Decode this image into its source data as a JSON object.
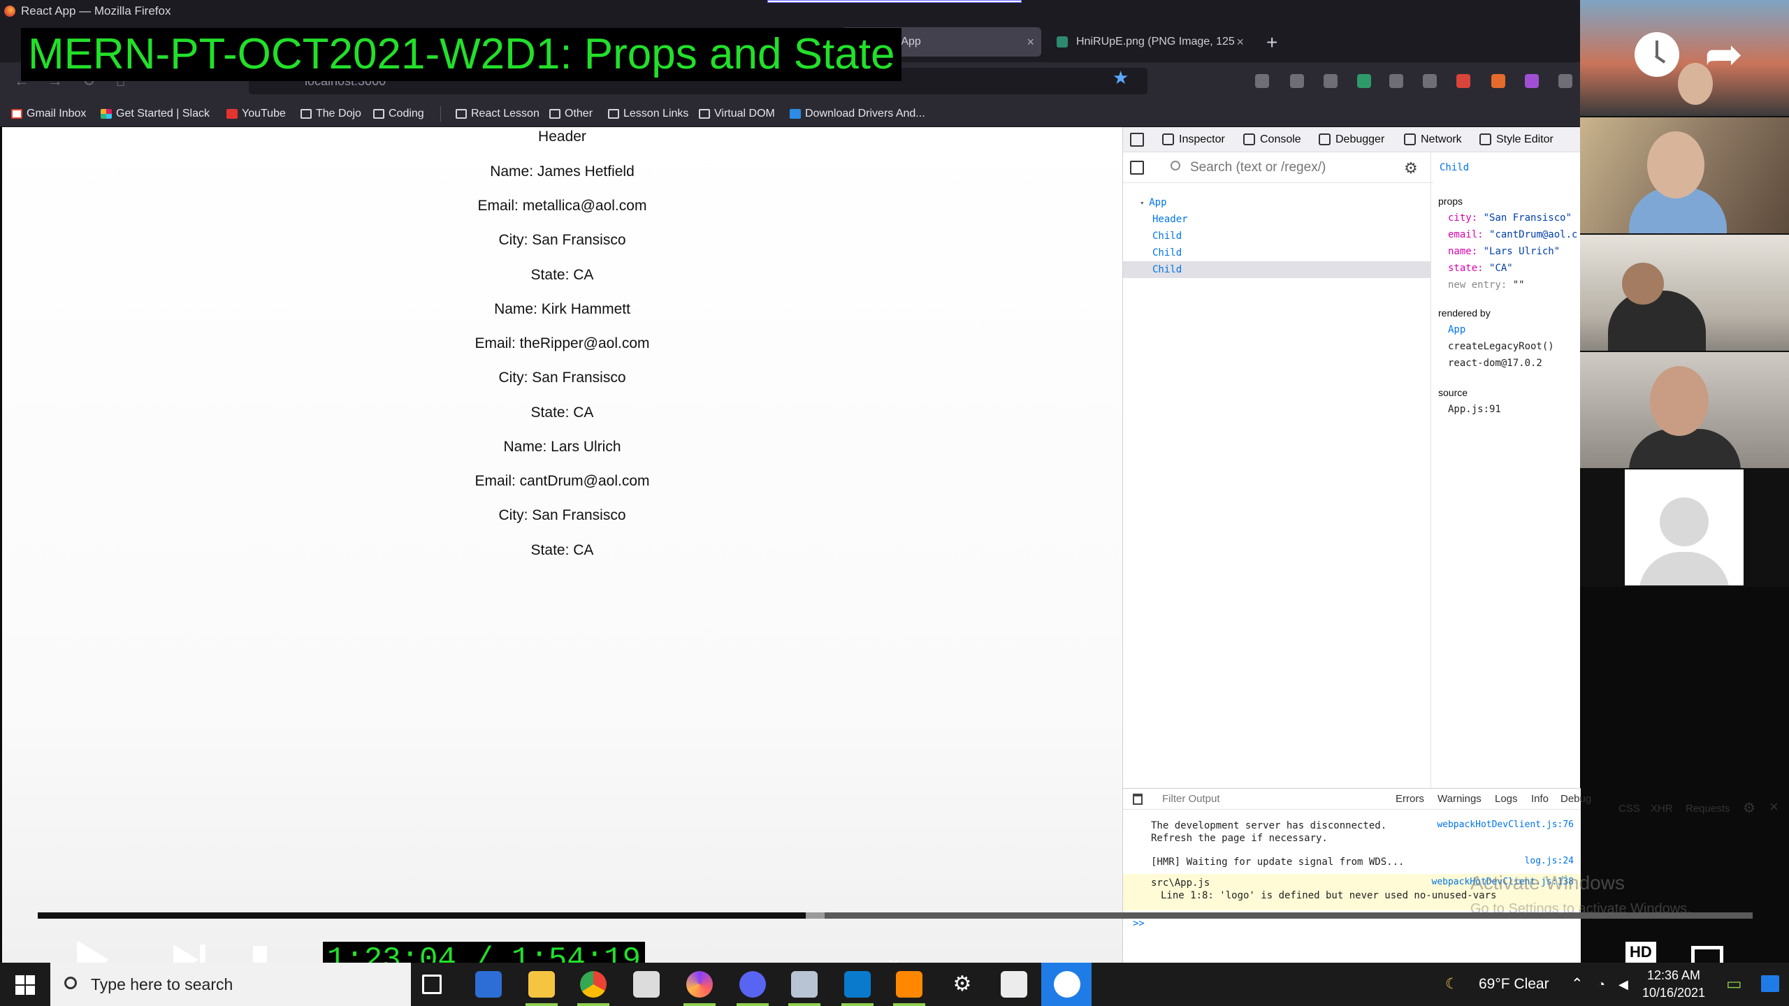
{
  "window": {
    "title": "React App — Mozilla Firefox"
  },
  "video": {
    "title": "MERN-PT-OCT2021-W2D1: Props and State",
    "time": "1:23:04 / 1:54:19",
    "progress": 0.448,
    "buffered": 0.459,
    "quality_badge": "HD"
  },
  "tabs": [
    {
      "label": "React App",
      "close": "×"
    },
    {
      "label": "HniRUpE.png (PNG Image, 125",
      "close": "×"
    }
  ],
  "new_tab": "+",
  "navbar": {
    "url": "localhost:3000"
  },
  "bookmarks": [
    {
      "label": "Gmail Inbox",
      "icon": "gmail-icon"
    },
    {
      "label": "Get Started | Slack",
      "icon": "slack-icon"
    },
    {
      "label": "YouTube",
      "icon": "youtube-icon"
    },
    {
      "label": "The Dojo",
      "icon": "folder-icon"
    },
    {
      "label": "Coding",
      "icon": "folder-icon"
    },
    {
      "label": "React Lesson",
      "icon": "folder-icon"
    },
    {
      "label": "Other",
      "icon": "folder-icon"
    },
    {
      "label": "Lesson Links",
      "icon": "folder-icon"
    },
    {
      "label": "Virtual DOM",
      "icon": "folder-icon"
    },
    {
      "label": "Download Drivers And...",
      "icon": "download-icon"
    }
  ],
  "page": {
    "lines": [
      "Header",
      "Name: James Hetfield",
      "Email: metallica@aol.com",
      "City: San Fransisco",
      "State: CA",
      "Name: Kirk Hammett",
      "Email: theRipper@aol.com",
      "City: San Fransisco",
      "State: CA",
      "Name: Lars Ulrich",
      "Email: cantDrum@aol.com",
      "City: San Fransisco",
      "State: CA"
    ]
  },
  "devtools": {
    "tabs": [
      "Inspector",
      "Console",
      "Debugger",
      "Network",
      "Style Editor"
    ],
    "search_placeholder": "Search (text or /regex/)",
    "tree": [
      "App",
      "Header",
      "Child",
      "Child",
      "Child"
    ],
    "selected": "Child",
    "props_label": "props",
    "props": [
      {
        "key": "city:",
        "value": "\"San Fransisco\""
      },
      {
        "key": "email:",
        "value": "\"cantDrum@aol.c"
      },
      {
        "key": "name:",
        "value": "\"Lars Ulrich\""
      },
      {
        "key": "state:",
        "value": "\"CA\""
      },
      {
        "key": "new entry:",
        "value": "\"\""
      }
    ],
    "rendered_by_label": "rendered by",
    "rendered_by": [
      "App",
      "createLegacyRoot()",
      "react-dom@17.0.2"
    ],
    "source_label": "source",
    "source": "App.js:91"
  },
  "console": {
    "filter_placeholder": "Filter Output",
    "filters": [
      "Errors",
      "Warnings",
      "Logs",
      "Info",
      "Debug",
      "CSS",
      "XHR",
      "Requests"
    ],
    "messages": [
      {
        "text1": "The development server has disconnected.",
        "text2": "Refresh the page if necessary.",
        "source": "webpackHotDevClient.js:76"
      },
      {
        "text1": "[HMR] Waiting for update signal from WDS...",
        "text2": "",
        "source": "log.js:24"
      },
      {
        "text1": "src\\App.js",
        "text2": "Line 1:8:  'logo' is defined but never used  no-unused-vars",
        "source": "webpackHotDevClient.js:138"
      }
    ],
    "prompt": ">>"
  },
  "watermark": {
    "line1": "Activate Windows",
    "line2": "Go to Settings to activate Windows."
  },
  "taskbar": {
    "search_placeholder": "Type here to search",
    "weather": "69°F  Clear",
    "time": "12:36 AM",
    "date": "10/16/2021"
  }
}
